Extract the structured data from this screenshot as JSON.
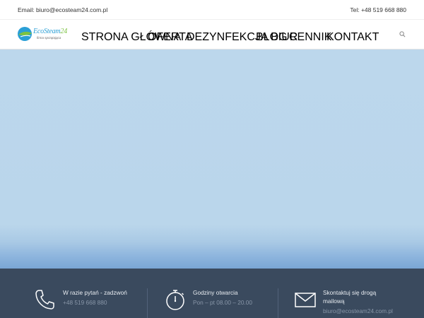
{
  "topbar": {
    "email": "Email: biuro@ecosteam24.com.pl",
    "phone": "Tel: +48 519 668 880"
  },
  "logo": {
    "brand_a": "EcoSteam",
    "brand_b": "24",
    "tagline": "firma sprzątająca"
  },
  "nav": {
    "items": [
      "STRONA GŁÓWNA",
      "OFERTA",
      "DEZYNFEKCJA BIUR",
      "BLOG",
      "CENNIK",
      "KONTAKT"
    ],
    "search_icon": "search-icon"
  },
  "footer": {
    "blocks": [
      {
        "title": "W razie pytań - zadzwoń",
        "sub": "+48 519 668 880",
        "icon": "phone-icon"
      },
      {
        "title": "Godziny otwarcia",
        "sub": "Pon – pt 08.00 – 20.00",
        "icon": "stopwatch-icon"
      },
      {
        "title": "Skontaktuj się drogą",
        "title2": "mailową",
        "sub": "biuro@ecosteam24.com.pl",
        "icon": "envelope-icon"
      }
    ]
  },
  "colors": {
    "hero": "#bcd7ec",
    "footer": "#3a4a5e",
    "brand_blue": "#2a9fd6",
    "brand_green": "#7cc242"
  }
}
